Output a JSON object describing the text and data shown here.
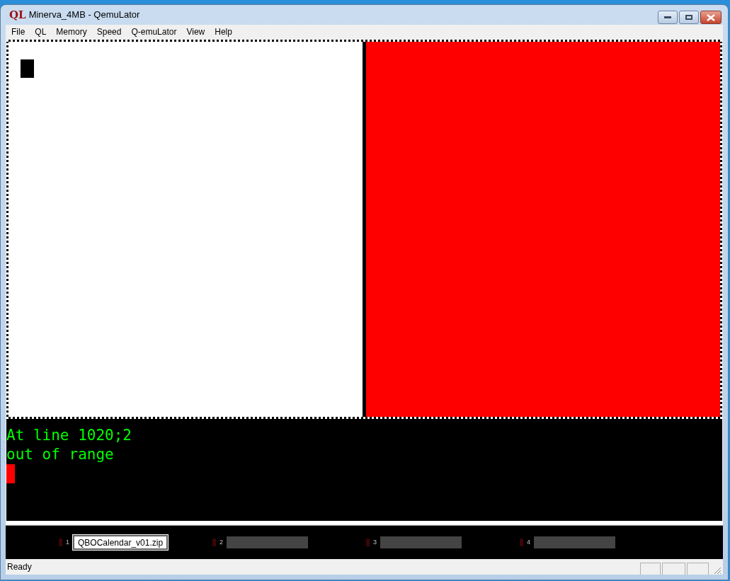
{
  "window": {
    "title": "Minerva_4MB - QemuLator",
    "app_icon": "QL"
  },
  "menu": [
    "File",
    "QL",
    "Memory",
    "Speed",
    "Q-emuLator",
    "View",
    "Help"
  ],
  "screen": {
    "panes": [
      {
        "color": "#ffffff",
        "cursor": true
      },
      {
        "color": "#ff0000",
        "cursor": false
      }
    ]
  },
  "console": {
    "lines": [
      "At line 1020;2",
      "out of range"
    ],
    "cursor": true
  },
  "drives": [
    {
      "number": "1",
      "file": "QBOCalendar_v01.zip",
      "loaded": true,
      "led_on": false
    },
    {
      "number": "2",
      "loaded": false,
      "led_on": false
    },
    {
      "number": "3",
      "loaded": false,
      "led_on": false
    },
    {
      "number": "4",
      "loaded": false,
      "led_on": false
    }
  ],
  "status_bar": {
    "text": "Ready"
  }
}
